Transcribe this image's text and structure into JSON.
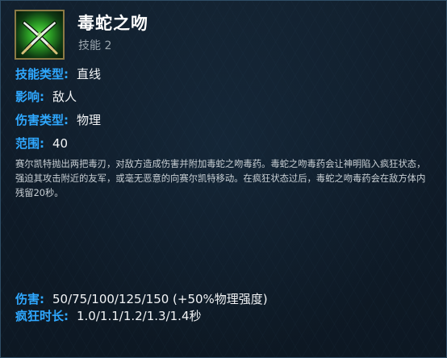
{
  "ability": {
    "icon": "crossed-blades-icon",
    "name": "毒蛇之吻",
    "slot": "技能 2"
  },
  "stats": [
    {
      "label": "技能类型:",
      "value": "直线"
    },
    {
      "label": "影响:",
      "value": "敌人"
    },
    {
      "label": "伤害类型:",
      "value": "物理"
    },
    {
      "label": "范围:",
      "value": "40"
    }
  ],
  "description": "赛尔凯特抛出两把毒刃，对敌方造成伤害并附加毒蛇之吻毒药。毒蛇之吻毒药会让神明陷入疯狂状态，强迫其攻击附近的友军，或毫无恶意的向赛尔凯特移动。在疯狂状态过后，毒蛇之吻毒药会在敌方体内残留20秒。",
  "scaling": [
    {
      "label": "伤害:",
      "value": "50/75/100/125/150  (+50%物理强度)"
    },
    {
      "label": "疯狂时长:",
      "value": "1.0/1.1/1.2/1.3/1.4秒"
    }
  ],
  "colors": {
    "label": "#2fa8ff",
    "border": "#2f4e66",
    "background": "#0f1b28",
    "icon_glow": "#5ee04a"
  }
}
